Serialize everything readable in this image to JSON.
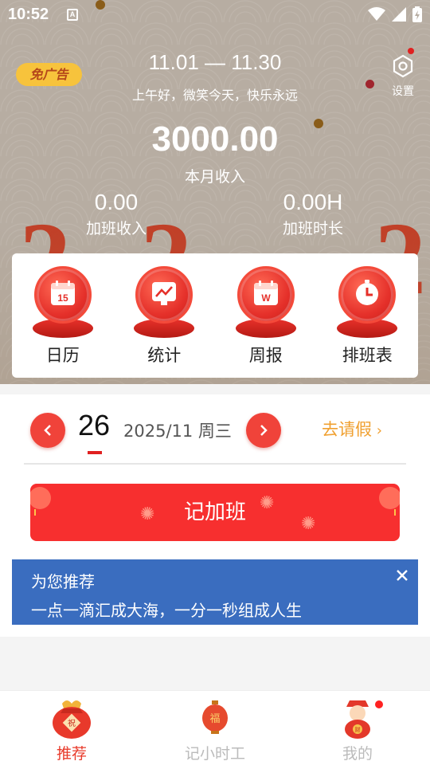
{
  "status_bar": {
    "time": "10:52",
    "notif_letter": "A"
  },
  "header": {
    "ad_free_badge": "免广告",
    "date_range": "11.01 — 11.30",
    "greeting": "上午好，微笑今天，快乐永远",
    "settings_label": "设置",
    "monthly_income_value": "3000.00",
    "monthly_income_label": "本月收入",
    "overtime_income_value": "0.00",
    "overtime_income_label": "加班收入",
    "overtime_hours_value": "0.00H",
    "overtime_hours_label": "加班时长"
  },
  "features": [
    {
      "label": "日历",
      "icon": "calendar-icon",
      "icon_text": "15"
    },
    {
      "label": "统计",
      "icon": "chart-icon"
    },
    {
      "label": "周报",
      "icon": "weekly-report-icon",
      "icon_text": "W"
    },
    {
      "label": "排班表",
      "icon": "clock-icon"
    }
  ],
  "date_selector": {
    "day": "26",
    "month_week": "2025/11 周三",
    "leave_link": "去请假"
  },
  "record_button": {
    "label": "记加班"
  },
  "recommend": {
    "title": "为您推荐",
    "text": "一点一滴汇成大海，一分一秒组成人生"
  },
  "tabbar": {
    "tabs": [
      {
        "label": "推荐",
        "active": true,
        "color": "#e83a2a"
      },
      {
        "label": "记小时工",
        "active": false,
        "color": "#bbbbbb"
      },
      {
        "label": "我的",
        "active": false,
        "color": "#bbbbbb",
        "badge": true
      }
    ]
  },
  "colors": {
    "accent_red": "#f72f2f",
    "recommend_blue": "#3a6dbf",
    "leave_orange": "#f0a030",
    "badge_yellow": "#f7c33c"
  }
}
